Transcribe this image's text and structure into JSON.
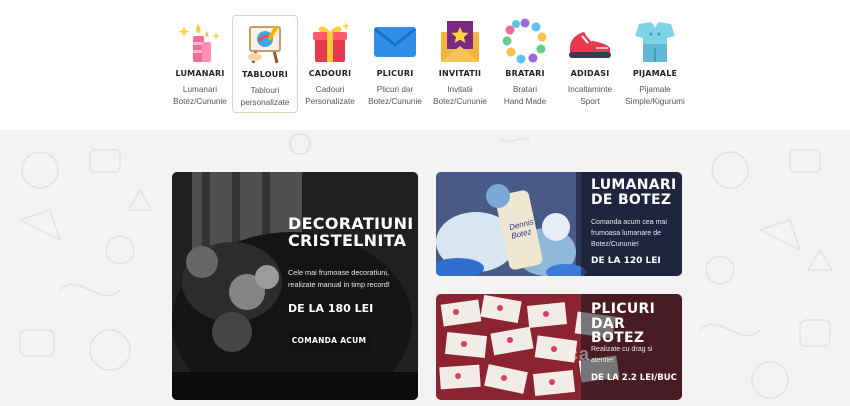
{
  "categories": [
    {
      "name": "LUMANARI",
      "sub": "Lumanari\nBotez/Cununie",
      "icon": "candles-icon"
    },
    {
      "name": "TABLOURI",
      "sub": "Tablouri\npersonalizate",
      "icon": "easel-painting-icon"
    },
    {
      "name": "CADOURI",
      "sub": "Cadouri\nPersonalizate",
      "icon": "gift-box-icon"
    },
    {
      "name": "PLICURI",
      "sub": "Plicuri dar\nBotez/Cununie",
      "icon": "envelope-icon"
    },
    {
      "name": "INVITATII",
      "sub": "Invitatii\nBotez/Cununie",
      "icon": "invitation-envelope-icon"
    },
    {
      "name": "BRATARI",
      "sub": "Bratari\nHand Made",
      "icon": "bead-bracelet-icon"
    },
    {
      "name": "ADIDASI",
      "sub": "Incaltaminte\nSport",
      "icon": "sneaker-icon"
    },
    {
      "name": "PIJAMALE",
      "sub": "Pijamale\nSimple/Kigurumi",
      "icon": "pajamas-icon"
    }
  ],
  "banners": {
    "main": {
      "title": "DECORATIUNI\nCRISTELNITA",
      "desc": "Cele mai frumoase decoratiuni,\nrealizate manual in timp record!",
      "price": "DE LA 180 LEI",
      "button": "COMANDA ACUM"
    },
    "candles": {
      "title": "LUMANARI\nDE BOTEZ",
      "desc": "Comanda acum cea mai\nfrumoasa lumanare de\nBotez/Cununie!",
      "price": "DE LA 120 LEI",
      "photo_text": "Dennis\nBotez"
    },
    "envelopes": {
      "title": "PLICURI\nDAR BOTEZ",
      "desc": "Realizate cu drag si\natentie!",
      "price": "DE LA 2.2 LEI/BUC"
    }
  },
  "watermark": "ca",
  "colors": {
    "active_border": "#e3d2b4",
    "dark_button": "#111111",
    "background": "#f3f3f3"
  }
}
